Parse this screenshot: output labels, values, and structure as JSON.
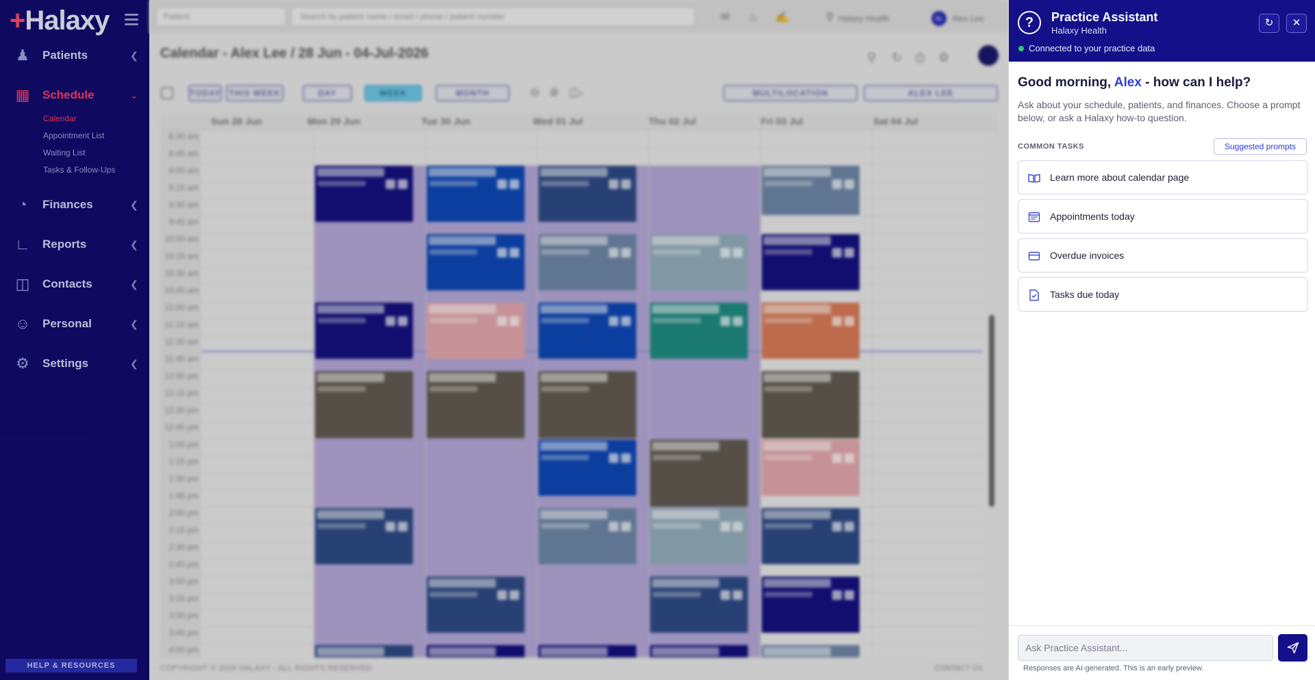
{
  "sidebar": {
    "logo": "Halaxy",
    "nav": [
      {
        "label": "Patients",
        "icon": "users-icon"
      },
      {
        "label": "Schedule",
        "icon": "calendar-icon",
        "active": true
      },
      {
        "label": "Finances",
        "icon": "pie-chart-icon"
      },
      {
        "label": "Reports",
        "icon": "line-chart-icon"
      },
      {
        "label": "Contacts",
        "icon": "address-book-icon"
      },
      {
        "label": "Personal",
        "icon": "person-icon"
      },
      {
        "label": "Settings",
        "icon": "gear-icon"
      }
    ],
    "schedule_sub": [
      "Calendar",
      "Appointment List",
      "Waiting List",
      "Tasks & Follow-Ups"
    ],
    "help_button": "HELP & RESOURCES"
  },
  "topbar": {
    "patient_select": "Patient",
    "search_placeholder": "Search by patient name / email / phone / patient number",
    "location": "Halaxy Health",
    "user_initials": "AL",
    "user_name": "Alex Lee"
  },
  "calendar": {
    "title": "Calendar - Alex Lee / 28 Jun - 04-Jul-2026",
    "toolbar": {
      "today": "TODAY",
      "this_week": "THIS WEEK",
      "day": "DAY",
      "week": "WEEK",
      "month": "MONTH",
      "columns_count": "4",
      "multilocation": "MULTILOCATION",
      "practitioner": "ALEX LEE"
    },
    "days": [
      "Sun 28 Jun",
      "Mon 29 Jun",
      "Tue 30 Jun",
      "Wed 01 Jul",
      "Thu 02 Jul",
      "Fri 03 Jul",
      "Sat 04 Jul"
    ],
    "times": [
      "8:30 am",
      "8:45 am",
      "9:00 am",
      "9:15 am",
      "9:30 am",
      "9:45 am",
      "10:00 am",
      "10:15 am",
      "10:30 am",
      "10:45 am",
      "11:00 am",
      "11:15 am",
      "11:30 am",
      "11:45 am",
      "12:00 pm",
      "12:15 pm",
      "12:30 pm",
      "12:45 pm",
      "1:00 pm",
      "1:15 pm",
      "1:30 pm",
      "1:45 pm",
      "2:00 pm",
      "2:15 pm",
      "2:30 pm",
      "2:45 pm",
      "3:00 pm",
      "3:15 pm",
      "3:30 pm",
      "3:45 pm",
      "4:00 pm"
    ],
    "footer": "COPYRIGHT © 2026 HALAXY - ALL RIGHTS RESERVED",
    "contact": "CONTACT US"
  },
  "assistant": {
    "title": "Practice Assistant",
    "subtitle": "Halaxy Health",
    "status": "Connected to your practice data",
    "greeting_prefix": "Good morning, ",
    "greeting_name": "Alex",
    "greeting_suffix": " - how can I help?",
    "intro": "Ask about your schedule, patients, and finances. Choose a prompt below, or ask a Halaxy how-to question.",
    "common_tasks_label": "COMMON TASKS",
    "suggested_prompts": "Suggested prompts",
    "tasks": [
      {
        "label": "Learn more about calendar page",
        "icon": "book-icon"
      },
      {
        "label": "Appointments today",
        "icon": "calendar-list-icon"
      },
      {
        "label": "Overdue invoices",
        "icon": "credit-card-icon"
      },
      {
        "label": "Tasks due today",
        "icon": "checklist-icon"
      }
    ],
    "input_placeholder": "Ask Practice Assistant...",
    "disclaimer": "Responses are AI-generated. This is an early preview."
  }
}
